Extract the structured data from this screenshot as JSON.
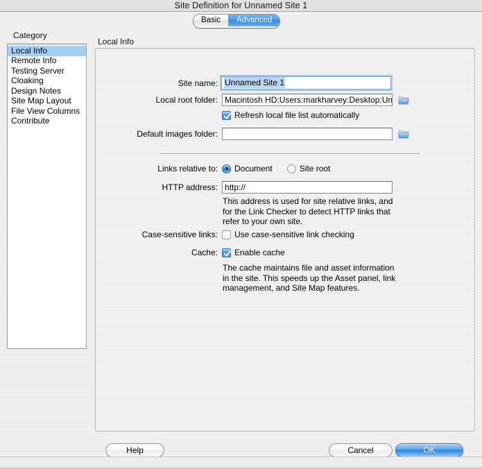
{
  "window": {
    "title": "Site Definition for Unnamed Site 1"
  },
  "tabs": [
    {
      "label": "Basic",
      "active": false
    },
    {
      "label": "Advanced",
      "active": true
    }
  ],
  "sidebar": {
    "title": "Category",
    "items": [
      {
        "label": "Local Info",
        "selected": true
      },
      {
        "label": "Remote Info",
        "selected": false
      },
      {
        "label": "Testing Server",
        "selected": false
      },
      {
        "label": "Cloaking",
        "selected": false
      },
      {
        "label": "Design Notes",
        "selected": false
      },
      {
        "label": "Site Map Layout",
        "selected": false
      },
      {
        "label": "File View Columns",
        "selected": false
      },
      {
        "label": "Contribute",
        "selected": false
      }
    ]
  },
  "content": {
    "title": "Local Info",
    "site_name": {
      "label": "Site name:",
      "value": "Unnamed Site 1",
      "selected": true
    },
    "local_root_folder": {
      "label": "Local root folder:",
      "value": "Macintosh HD:Users:markharvey:Desktop:Unn",
      "browse_icon": "folder-icon"
    },
    "refresh_local": {
      "label": "Refresh local file list automatically",
      "checked": true
    },
    "default_images_folder": {
      "label": "Default images folder:",
      "value": "",
      "browse_icon": "folder-icon"
    },
    "links_relative_to": {
      "label": "Links relative to:",
      "options": [
        {
          "label": "Document",
          "selected": true
        },
        {
          "label": "Site root",
          "selected": false
        }
      ]
    },
    "http_address": {
      "label": "HTTP address:",
      "value": "http://",
      "help": "This address is used for site relative links, and for the Link Checker to detect HTTP links that refer to your own site."
    },
    "case_sensitive_links": {
      "label": "Case-sensitive links:",
      "checkbox_label": "Use case-sensitive link checking",
      "checked": false
    },
    "cache": {
      "label": "Cache:",
      "checkbox_label": "Enable cache",
      "checked": true,
      "help": "The cache maintains file and asset information in the site.  This speeds up the Asset panel, link management, and Site Map features."
    }
  },
  "buttons": {
    "help": "Help",
    "cancel": "Cancel",
    "ok": "OK"
  },
  "colors": {
    "accent": "#2f88e0",
    "selection": "#a5cdf5",
    "text_selection": "#b9d5f1"
  }
}
